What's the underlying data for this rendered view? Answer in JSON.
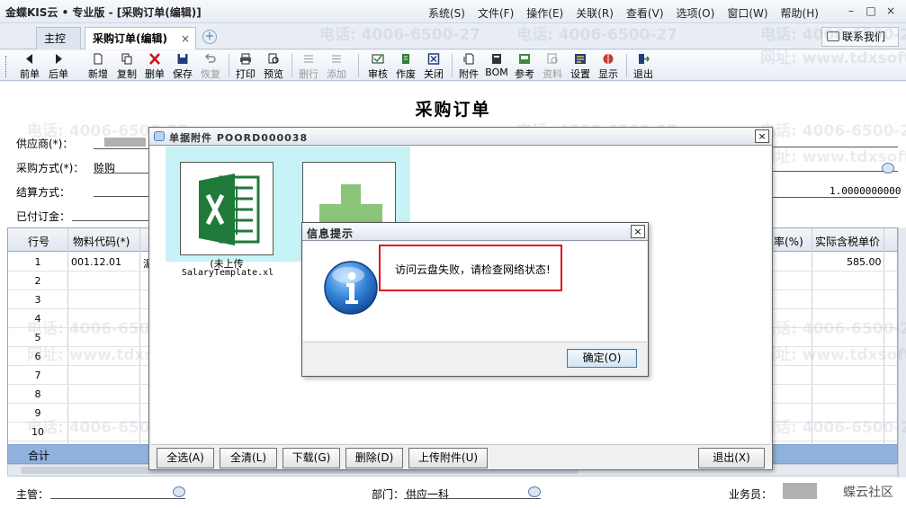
{
  "window": {
    "title": "金蝶KIS云 • 专业版 - [采购订单(编辑)]",
    "controls": [
      "–",
      "□",
      "×"
    ]
  },
  "menu": [
    "系统(S)",
    "文件(F)",
    "操作(E)",
    "关联(R)",
    "查看(V)",
    "选项(O)",
    "窗口(W)",
    "帮助(H)"
  ],
  "tabs": [
    {
      "label": "主控台"
    },
    {
      "label": "采购订单(编辑)",
      "close": "×"
    }
  ],
  "tab_add": "+",
  "contact_label": "联系我们",
  "toolbar": [
    {
      "label": "前单",
      "enabled": true
    },
    {
      "label": "后单",
      "enabled": true
    },
    {
      "label": "新增",
      "enabled": true
    },
    {
      "label": "复制",
      "enabled": true
    },
    {
      "label": "删单",
      "enabled": true
    },
    {
      "label": "保存",
      "enabled": true
    },
    {
      "label": "恢复",
      "enabled": false
    },
    {
      "label": "打印",
      "enabled": true
    },
    {
      "label": "预览",
      "enabled": true
    },
    {
      "label": "删行",
      "enabled": false
    },
    {
      "label": "添加",
      "enabled": false
    },
    {
      "label": "审核",
      "enabled": true
    },
    {
      "label": "作废",
      "enabled": true
    },
    {
      "label": "关闭",
      "enabled": true
    },
    {
      "label": "附件",
      "enabled": true
    },
    {
      "label": "BOM",
      "enabled": true
    },
    {
      "label": "参考",
      "enabled": true
    },
    {
      "label": "资料",
      "enabled": false
    },
    {
      "label": "设置",
      "enabled": true
    },
    {
      "label": "显示",
      "enabled": true
    },
    {
      "label": "退出",
      "enabled": true
    }
  ],
  "form": {
    "title": "采购订单",
    "supplier_label": "供应商(*)：",
    "purchase_method_label": "采购方式(*)：",
    "purchase_method_value": "赊购",
    "settlement_label": "结算方式：",
    "deposit_label": "已付订金：",
    "rate_value": "1.0000000000",
    "manager_label": "主管：",
    "department_label": "部门：",
    "department_value": "供应一科",
    "salesman_label": "业务员："
  },
  "grid": {
    "columns": [
      "行号",
      "物料代码(*)",
      "率(%)",
      "实际含税单价"
    ],
    "rows": [
      {
        "no": "1",
        "code": "001.12.01",
        "price": "585.00"
      },
      {
        "no": "2",
        "code": "",
        "price": ""
      },
      {
        "no": "3",
        "code": "",
        "price": ""
      },
      {
        "no": "4",
        "code": "",
        "price": ""
      },
      {
        "no": "5",
        "code": "",
        "price": ""
      },
      {
        "no": "6",
        "code": "",
        "price": ""
      },
      {
        "no": "7",
        "code": "",
        "price": ""
      },
      {
        "no": "8",
        "code": "",
        "price": ""
      },
      {
        "no": "9",
        "code": "",
        "price": ""
      },
      {
        "no": "10",
        "code": "",
        "price": ""
      }
    ],
    "sum_label": "合计",
    "partial_cell": "湄"
  },
  "attachment_window": {
    "title": "单据附件  POORD000038",
    "close": "×",
    "file_status": "(未上传",
    "file_name": "SalaryTemplate.xl",
    "buttons": [
      "全选(A)",
      "全清(L)",
      "下载(G)",
      "删除(D)",
      "上传附件(U)",
      "退出(X)"
    ]
  },
  "message_dialog": {
    "title": "信息提示",
    "close": "×",
    "message": "访问云盘失败，请检查网络状态!",
    "ok_label": "确定(O)",
    "highlight_color": "#e0161b"
  },
  "watermark": {
    "phone": "电话: 4006-6500-27",
    "site": "网址: www.tdxsoft.com"
  },
  "bottom_logo": "蝶云社区"
}
